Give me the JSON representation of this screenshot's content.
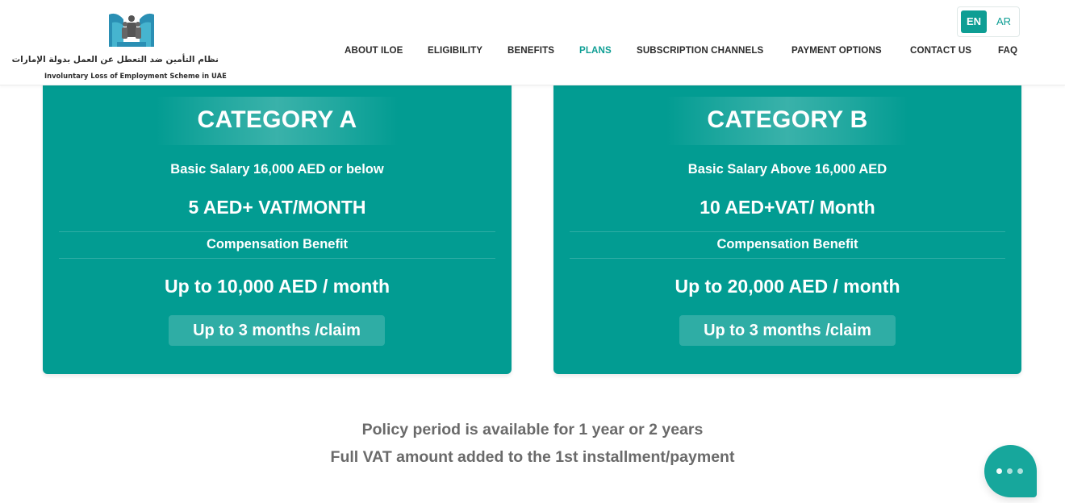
{
  "header": {
    "logo": {
      "arabic_text": "نظام التأمين ضد التعطل عن العمل بدولة الإمارات",
      "english_text": "Involuntary Loss of Employment Scheme in UAE"
    },
    "language": {
      "en_label": "EN",
      "ar_label": "AR",
      "selected": "EN"
    },
    "nav": [
      {
        "label": "ABOUT ILOE"
      },
      {
        "label": "ELIGIBILITY"
      },
      {
        "label": "BENEFITS"
      },
      {
        "label": "PLANS",
        "active": true
      },
      {
        "label": "SUBSCRIPTION CHANNELS"
      },
      {
        "label": "PAYMENT OPTIONS"
      },
      {
        "label": "CONTACT US"
      },
      {
        "label": "FAQ"
      }
    ]
  },
  "plans": [
    {
      "title": "CATEGORY A",
      "salary": "Basic Salary 16,000 AED or below",
      "price": "5 AED+ VAT/MONTH",
      "benefit_label": "Compensation Benefit",
      "benefit_amount": "Up to 10,000 AED / month",
      "claim_duration": "Up to 3 months /claim"
    },
    {
      "title": "CATEGORY B",
      "salary": "Basic Salary Above 16,000 AED",
      "price": "10 AED+VAT/ Month",
      "benefit_label": "Compensation Benefit",
      "benefit_amount": "Up to 20,000 AED / month",
      "claim_duration": "Up to 3 months /claim"
    }
  ],
  "notes": {
    "policy_period": "Policy period is available for 1 year or 2 years",
    "vat": "Full VAT amount added to the 1st installment/payment"
  },
  "colors": {
    "accent": "#0e9e94",
    "card_background": "#029c92",
    "note_text": "#6a6a6a"
  },
  "icons": {
    "chat": "chat-bubble-icon"
  }
}
